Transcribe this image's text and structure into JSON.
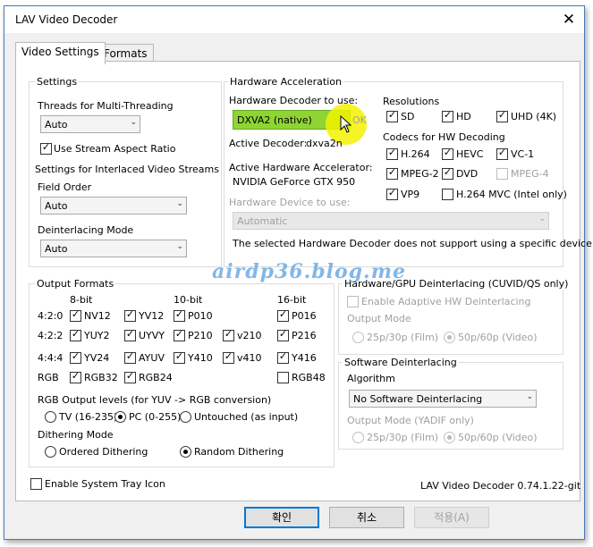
{
  "window": {
    "title": "LAV Video Decoder",
    "close_glyph": "✕"
  },
  "tabs": [
    {
      "label": "Video Settings"
    },
    {
      "label": "Formats"
    }
  ],
  "settings": {
    "group": "Settings",
    "threads_label": "Threads for Multi-Threading",
    "threads_value": "Auto",
    "aspect_label": "Use Stream Aspect Ratio",
    "interlaced_label": "Settings for Interlaced Video Streams",
    "field_order_label": "Field Order",
    "field_order_value": "Auto",
    "deint_mode_label": "Deinterlacing Mode",
    "deint_mode_value": "Auto"
  },
  "hw": {
    "group": "Hardware Acceleration",
    "decoder_label": "Hardware Decoder to use:",
    "decoder_value": "DXVA2 (native)",
    "ok_text": "OK",
    "active_decoder_label": "Active Decoder:",
    "active_decoder_value": "dxva2n",
    "active_accel_label": "Active Hardware Accelerator:",
    "active_accel_value": "NVIDIA GeForce GTX 950",
    "device_label": "Hardware Device to use:",
    "device_value": "Automatic",
    "note": "The selected Hardware Decoder does not support using a specific device.",
    "resolutions_label": "Resolutions",
    "resolutions": [
      "SD",
      "HD",
      "UHD (4K)"
    ],
    "codecs_label": "Codecs for HW Decoding",
    "codecs": [
      "H.264",
      "HEVC",
      "VC-1",
      "MPEG-2",
      "DVD",
      "MPEG-4",
      "VP9",
      "H.264 MVC (Intel only)"
    ]
  },
  "output": {
    "group": "Output Formats",
    "col_headers": [
      "8-bit",
      "10-bit",
      "16-bit"
    ],
    "row_labels": [
      "4:2:0",
      "4:2:2",
      "4:4:4",
      "RGB"
    ],
    "formats": [
      "NV12",
      "YV12",
      "P010",
      "P016",
      "YUY2",
      "UYVY",
      "P210",
      "v210",
      "P216",
      "YV24",
      "AYUV",
      "Y410",
      "v410",
      "Y416",
      "RGB32",
      "RGB24",
      "RGB48"
    ],
    "rgb_levels_label": "RGB Output levels (for YUV -> RGB conversion)",
    "rgb_levels": [
      "TV (16-235)",
      "PC (0-255)",
      "Untouched (as input)"
    ],
    "dither_label": "Dithering Mode",
    "dither": [
      "Ordered Dithering",
      "Random Dithering"
    ]
  },
  "gpu_deint": {
    "group": "Hardware/GPU Deinterlacing (CUVID/QS only)",
    "adaptive_label": "Enable Adaptive HW Deinterlacing",
    "output_mode_label": "Output Mode",
    "modes": [
      "25p/30p (Film)",
      "50p/60p (Video)"
    ]
  },
  "sw_deint": {
    "group": "Software Deinterlacing",
    "algorithm_label": "Algorithm",
    "algorithm_value": "No Software Deinterlacing",
    "output_mode_label": "Output Mode (YADIF only)",
    "modes": [
      "25p/30p (Film)",
      "50p/60p (Video)"
    ]
  },
  "footer": {
    "tray_label": "Enable System Tray Icon",
    "version": "LAV Video Decoder 0.74.1.22-git",
    "ok_button": "확인",
    "cancel_button": "취소",
    "apply_button": "적용(A)"
  },
  "watermark": "airdp36.blog.me",
  "colors": {
    "highlight_yellow": "#f2f200",
    "combo_active": "#8ed432",
    "disabled_text": "#a0a0a0",
    "accent_border": "#0078d7"
  }
}
